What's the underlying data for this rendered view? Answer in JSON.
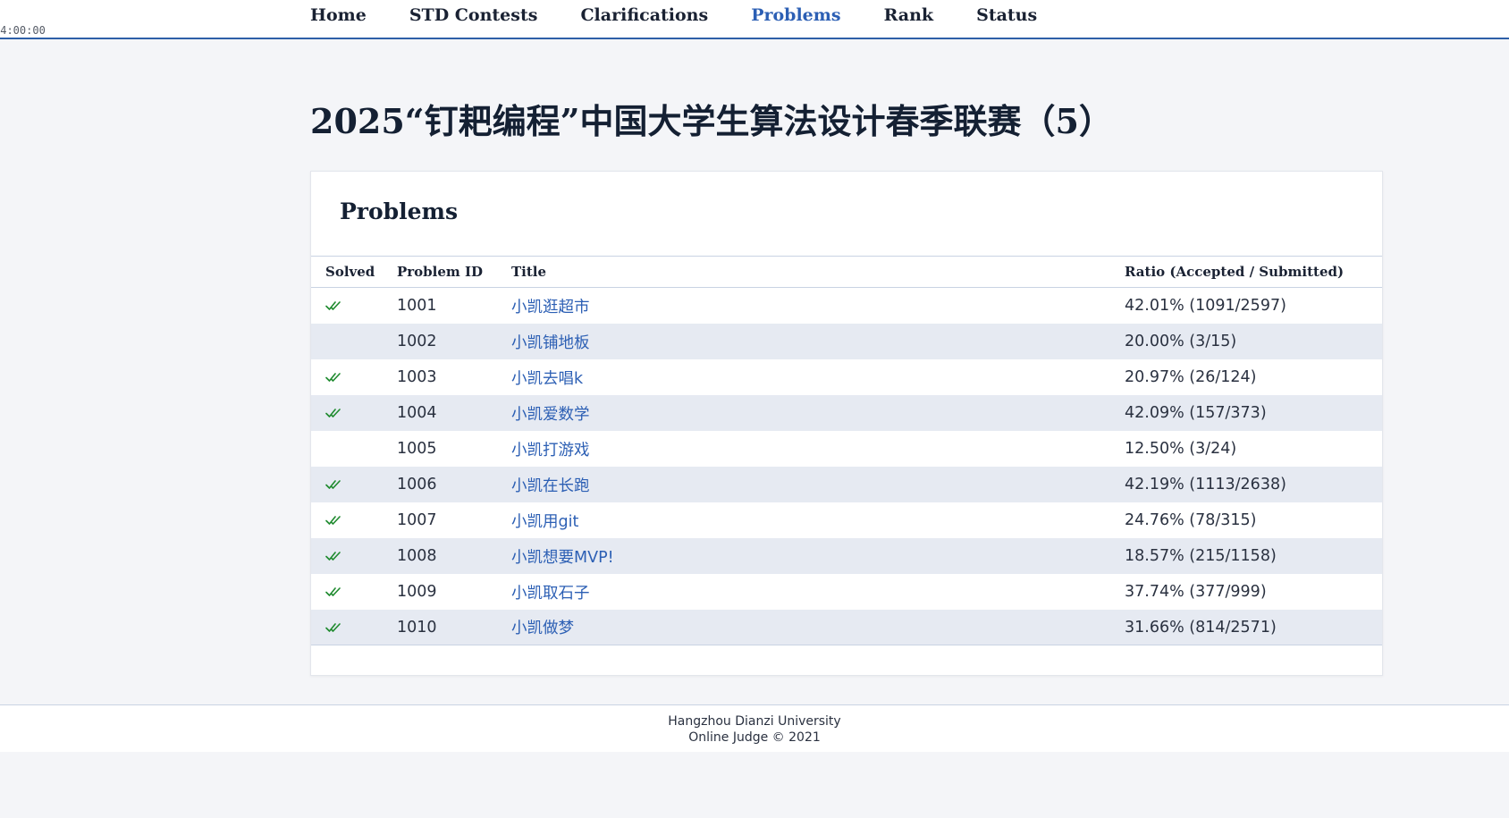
{
  "timer": "04:00:00",
  "nav": [
    {
      "label": "Home",
      "active": false
    },
    {
      "label": "STD Contests",
      "active": false
    },
    {
      "label": "Clarifications",
      "active": false
    },
    {
      "label": "Problems",
      "active": true
    },
    {
      "label": "Rank",
      "active": false
    },
    {
      "label": "Status",
      "active": false
    }
  ],
  "contest": {
    "title": "2025“钉耙编程”中国大学生算法设计春季联赛（5）"
  },
  "problems": {
    "heading": "Problems",
    "columns": {
      "solved": "Solved",
      "id": "Problem ID",
      "title": "Title",
      "ratio": "Ratio (Accepted / Submitted)"
    },
    "rows": [
      {
        "solved": true,
        "id": "1001",
        "title": "小凯逛超市",
        "ratio": "42.01% (1091/2597)"
      },
      {
        "solved": false,
        "id": "1002",
        "title": "小凯铺地板",
        "ratio": "20.00% (3/15)"
      },
      {
        "solved": true,
        "id": "1003",
        "title": "小凯去唱k",
        "ratio": "20.97% (26/124)"
      },
      {
        "solved": true,
        "id": "1004",
        "title": "小凯爱数学",
        "ratio": "42.09% (157/373)"
      },
      {
        "solved": false,
        "id": "1005",
        "title": "小凯打游戏",
        "ratio": "12.50% (3/24)"
      },
      {
        "solved": true,
        "id": "1006",
        "title": "小凯在长跑",
        "ratio": "42.19% (1113/2638)"
      },
      {
        "solved": true,
        "id": "1007",
        "title": "小凯用git",
        "ratio": "24.76% (78/315)"
      },
      {
        "solved": true,
        "id": "1008",
        "title": "小凯想要MVP!",
        "ratio": "18.57% (215/1158)"
      },
      {
        "solved": true,
        "id": "1009",
        "title": "小凯取石子",
        "ratio": "37.74% (377/999)"
      },
      {
        "solved": true,
        "id": "1010",
        "title": "小凯做梦",
        "ratio": "31.66% (814/2571)"
      }
    ]
  },
  "footer": {
    "line1": "Hangzhou Dianzi University",
    "line2": "Online Judge © 2021"
  },
  "colors": {
    "accent": "#2c5fb4",
    "check": "#1e8a2e"
  }
}
